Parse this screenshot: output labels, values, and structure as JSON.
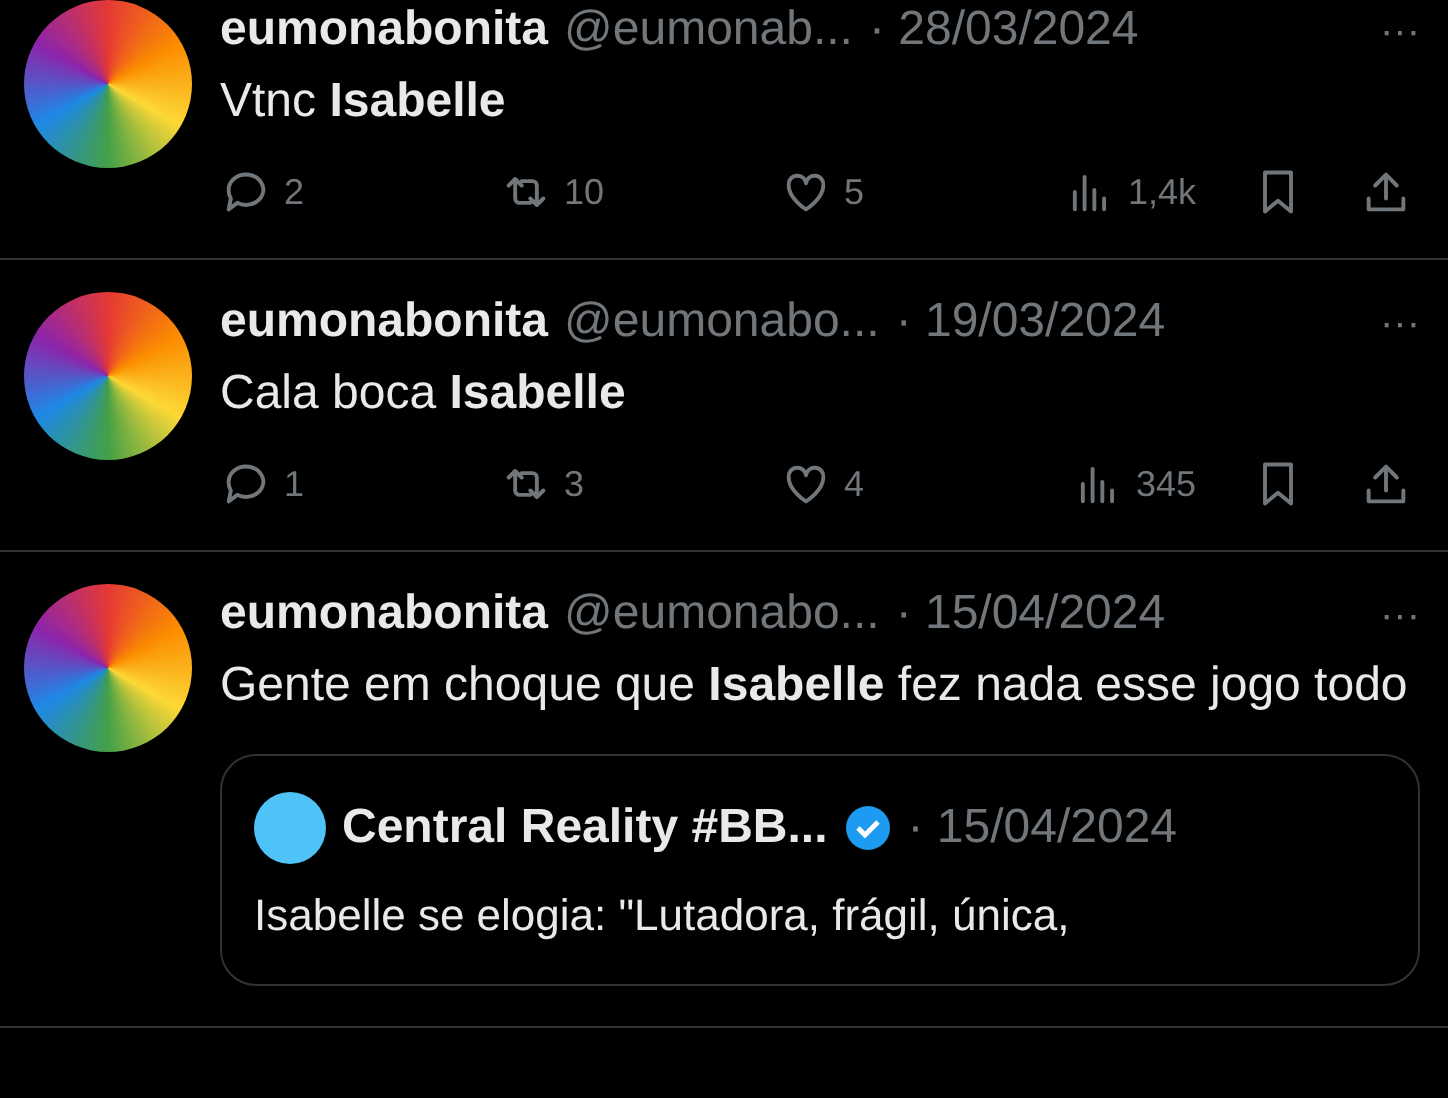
{
  "tweets": [
    {
      "name": "eumonabonita",
      "handle": "@eumonab...",
      "date": "· 28/03/2024",
      "more": "···",
      "text": "Vtnc **Isabelle**",
      "replies": "2",
      "retweets": "10",
      "likes": "5",
      "views": "1,4k"
    },
    {
      "name": "eumonabonita",
      "handle": "@eumonabo...",
      "date": "· 19/03/2024",
      "more": "···",
      "text": "Cala boca **Isabelle**",
      "replies": "1",
      "retweets": "3",
      "likes": "4",
      "views": "345"
    },
    {
      "name": "eumonabonita",
      "handle": "@eumonabo...",
      "date": "· 15/04/2024",
      "more": "···",
      "text": "Gente em choque que **Isabelle** fez nada esse jogo todo",
      "quote": {
        "name": "Central Reality #BB...",
        "verified": true,
        "date": "· 15/04/2024",
        "text": "Isabelle se elogia: \"Lutadora, frágil, única,"
      }
    }
  ]
}
